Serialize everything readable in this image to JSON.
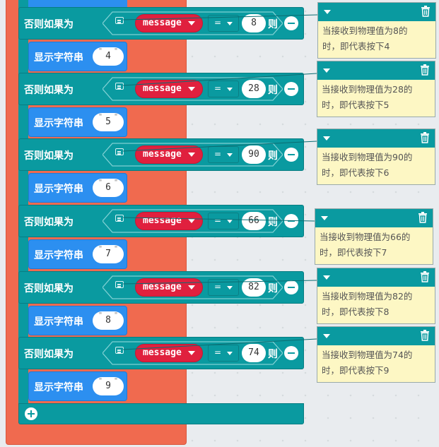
{
  "colors": {
    "if_block": "#0a9aa0",
    "show_block": "#2c8ff0",
    "message_block": "#e0203e",
    "note_body": "#fdf7c4",
    "outer": "#f06a4f"
  },
  "rows": [
    {
      "if_label": "否则如果为",
      "variable": "message",
      "operator": "=",
      "value": "8",
      "then_label": "则",
      "show_label": "显示字符串",
      "string": "4",
      "note_line1": "当接收到物理值为8的",
      "note_line2": "时，即代表按下4"
    },
    {
      "if_label": "否则如果为",
      "variable": "message",
      "operator": "=",
      "value": "28",
      "then_label": "则",
      "show_label": "显示字符串",
      "string": "5",
      "note_line1": "当接收到物理值为28的",
      "note_line2": "时，即代表按下5"
    },
    {
      "if_label": "否则如果为",
      "variable": "message",
      "operator": "=",
      "value": "90",
      "then_label": "则",
      "show_label": "显示字符串",
      "string": "6",
      "note_line1": "当接收到物理值为90的",
      "note_line2": "时，即代表按下6"
    },
    {
      "if_label": "否则如果为",
      "variable": "message",
      "operator": "=",
      "value": "66",
      "then_label": "则",
      "show_label": "显示字符串",
      "string": "7",
      "note_line1": "当接收到物理值为66的",
      "note_line2": "时，即代表按下7"
    },
    {
      "if_label": "否则如果为",
      "variable": "message",
      "operator": "=",
      "value": "82",
      "then_label": "则",
      "show_label": "显示字符串",
      "string": "8",
      "note_line1": "当接收到物理值为82的",
      "note_line2": "时，即代表按下8"
    },
    {
      "if_label": "否则如果为",
      "variable": "message",
      "operator": "=",
      "value": "74",
      "then_label": "则",
      "show_label": "显示字符串",
      "string": "9",
      "note_line1": "当接收到物理值为74的",
      "note_line2": "时，即代表按下9"
    }
  ],
  "icons": {
    "add": "plus-circle-icon",
    "remove": "minus-circle-icon",
    "comment": "comment-icon",
    "delete": "trash-icon",
    "collapse": "caret-down-icon"
  }
}
